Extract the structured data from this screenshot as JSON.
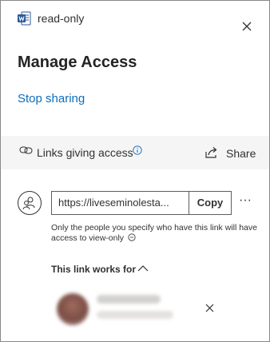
{
  "file": {
    "name": "read-only",
    "icon": "word-document-icon"
  },
  "header": {
    "title": "Manage Access",
    "stop_sharing_label": "Stop sharing"
  },
  "links_section": {
    "label": "Links giving access",
    "share_label": "Share"
  },
  "link": {
    "url": "https://liveseminolesta...",
    "copy_label": "Copy",
    "more_label": "···",
    "description": "Only the people you specify who have this link will have access to view-only",
    "works_for_label": "This link works for"
  },
  "colors": {
    "accent": "#0f6cbd",
    "band": "#f5f5f5",
    "border": "#8a8886"
  }
}
